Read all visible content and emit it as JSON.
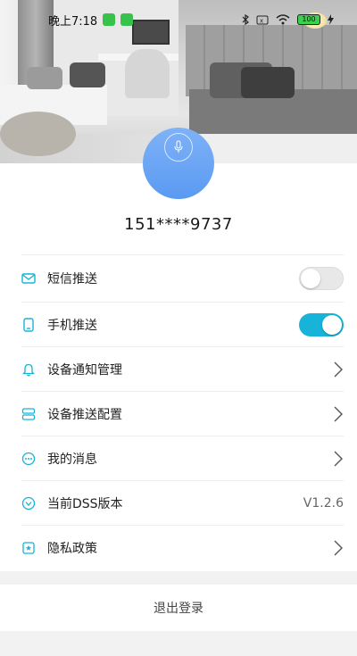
{
  "status_bar": {
    "time": "晚上7:18",
    "battery": "100"
  },
  "profile": {
    "phone": "151****9737"
  },
  "settings": [
    {
      "label": "短信推送",
      "icon": "message-icon",
      "control": "toggle",
      "state": "off"
    },
    {
      "label": "手机推送",
      "icon": "phone-icon",
      "control": "toggle",
      "state": "on"
    },
    {
      "label": "设备通知管理",
      "icon": "bell-icon",
      "control": "chevron"
    },
    {
      "label": "设备推送配置",
      "icon": "server-icon",
      "control": "chevron"
    },
    {
      "label": "我的消息",
      "icon": "chat-bubble-icon",
      "control": "chevron"
    },
    {
      "label": "当前DSS版本",
      "icon": "version-icon",
      "control": "value",
      "value": "V1.2.6"
    },
    {
      "label": "隐私政策",
      "icon": "star-document-icon",
      "control": "chevron"
    }
  ],
  "logout": {
    "label": "退出登录"
  },
  "colors": {
    "accent": "#17b3d9",
    "avatar": "#5a9af2",
    "background": "#f2f2f2"
  }
}
